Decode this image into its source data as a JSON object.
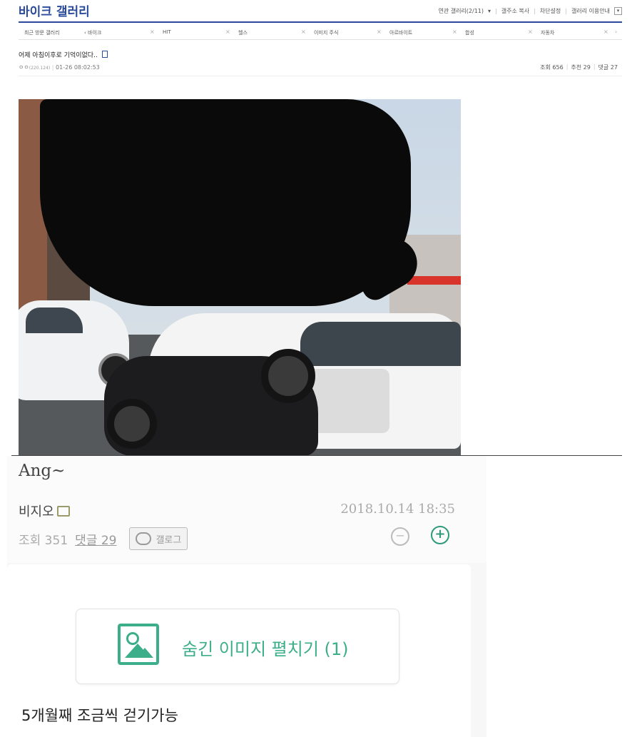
{
  "gallery": {
    "title": "바이크 갤러리",
    "header_links": [
      "연관 갤러리(2/11)",
      "갤주소 복사",
      "차단설정",
      "갤러리 이용안내"
    ],
    "recent_label": "최근 방문 갤러리",
    "recent_items": [
      "바이크",
      "HIT",
      "헬스",
      "이미지 주식",
      "아르바이트",
      "합성",
      "자동차"
    ]
  },
  "post": {
    "title": "어제 아침이후로 기억이없다..",
    "author_dots": "ㅇㅇ",
    "ip": "(220.124)",
    "date": "01-26 08:02:53",
    "views_label": "조회 656",
    "recommend_label": "추천 29",
    "comments_label": "댓글 27"
  },
  "comment": {
    "nickname": "Ang~",
    "author": "비지오",
    "datetime": "2018.10.14 18:35",
    "views": "조회 351",
    "comments": "댓글 29",
    "gallog": "갤로그",
    "zoom_out": "−",
    "zoom_in": "+",
    "expand_images": "숨긴 이미지 펼치기 (1)",
    "body": "5개월째 조금씩 걷기가능"
  },
  "colors": {
    "brand_blue": "#2b4a9c",
    "accent_green": "#3cae8a"
  },
  "icons": [
    "doc-icon",
    "dropdown-icon",
    "badge-icon",
    "gallog-icon",
    "zoom-out-icon",
    "zoom-in-icon",
    "image-icon"
  ]
}
